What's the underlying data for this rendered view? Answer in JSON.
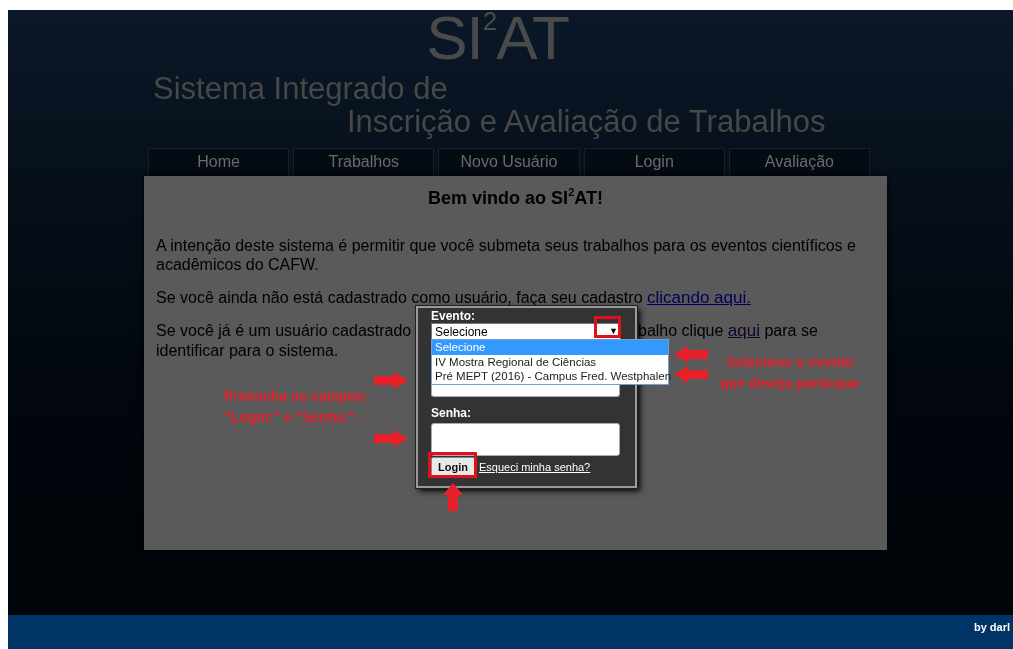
{
  "header": {
    "logo": "SI$^{2}$AT",
    "subtitle": [
      "Sistema Integrado de",
      "Inscrição e Avaliação de Trabalhos"
    ]
  },
  "nav": [
    {
      "label": "Home",
      "selected": false
    },
    {
      "label": "Trabalhos",
      "selected": false
    },
    {
      "label": "Novo Usuário",
      "selected": false
    },
    {
      "label": "Login",
      "selected": false
    },
    {
      "label": "Avaliação",
      "selected": false
    }
  ],
  "content": {
    "heading": "Bem vindo ao SI$^{2}$AT!",
    "intro": "A intenção deste sistema é permitir que você submeta seus trabalhos para os eventos científicos e acadêmicos do CAFW.",
    "signup": {
      "text": "Se você ainda não está cadastrado como usuário, faça seu cadastro",
      "link": "clicando aqui."
    },
    "returning": {
      "text_left": "Se você já é um usuário cadastrado",
      "text_right": "balho clique",
      "link": "aqui",
      "text_end": "para se",
      "line_2": "identificar para o sistema."
    }
  },
  "login_popup": {
    "event_label": "Evento:",
    "event_select": {
      "value": "Selecione",
      "caret": "▼",
      "expanded": true,
      "options": [
        {
          "label": "Selecione",
          "selected": true
        },
        {
          "label": "IV Mostra Regional de Ciências",
          "selected": false
        },
        {
          "label": "Pré MEPT (2016) - Campus Fred. Westphalen",
          "selected": false
        }
      ]
    },
    "password_label": "Senha:",
    "login_button": "Login",
    "forgot_link": "Esqueci minha senha?"
  },
  "annotations": {
    "event_note": [
      "Selecione o evento",
      "que deseja participar"
    ],
    "fields_note": [
      "Preencha os campos:",
      "\"Login:\" e \"Senha:\"."
    ]
  },
  "footer": {
    "credit": "by darl"
  }
}
